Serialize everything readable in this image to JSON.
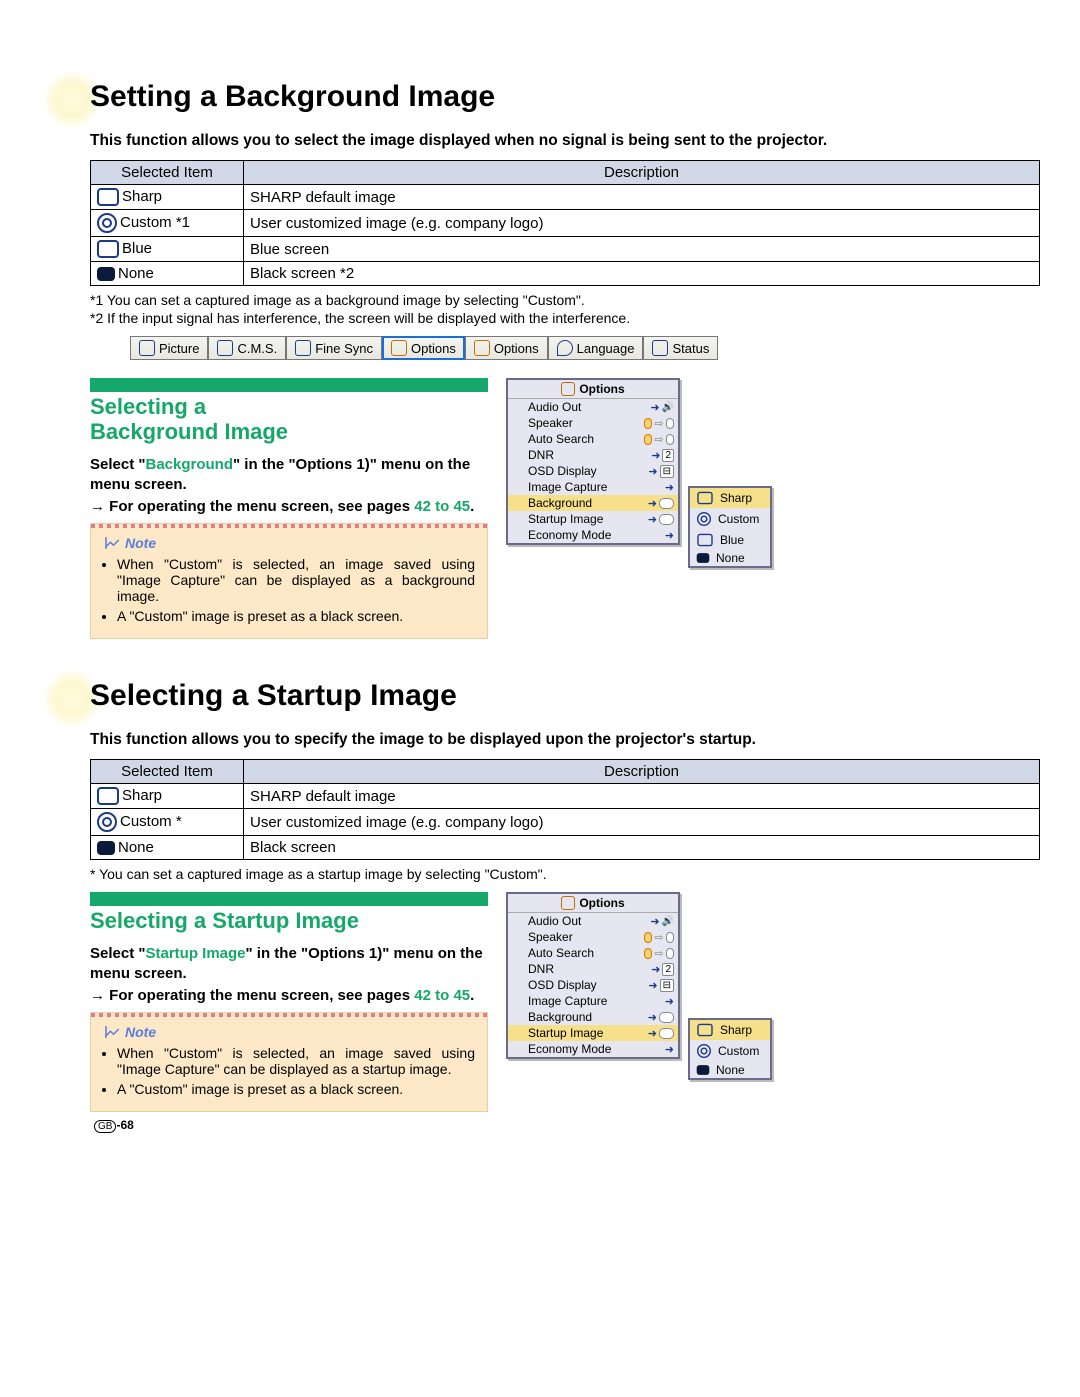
{
  "section1": {
    "title": "Setting a Background Image",
    "intro": "This function allows you to select the image displayed when no signal is being sent to the projector.",
    "table": {
      "headers": [
        "Selected Item",
        "Description"
      ],
      "rows": [
        {
          "item": "Sharp",
          "desc": "SHARP default image",
          "icon": "box"
        },
        {
          "item": "Custom *1",
          "desc": "User customized image (e.g. company logo)",
          "icon": "target"
        },
        {
          "item": "Blue",
          "desc": "Blue screen",
          "icon": "box"
        },
        {
          "item": "None",
          "desc": "Black screen *2",
          "icon": "dark"
        }
      ]
    },
    "footnotes": [
      "*1 You can set a captured image as a background image by selecting \"Custom\".",
      "*2 If the input signal has interference, the screen will be displayed with the interference."
    ]
  },
  "menu_tabs": [
    "Picture",
    "C.M.S.",
    "Fine Sync",
    "Options",
    "Options",
    "Language",
    "Status"
  ],
  "menu_tabs_selected_index": 3,
  "block1": {
    "heading_line1": "Selecting a",
    "heading_line2": "Background Image",
    "instr_a": "Select \"",
    "instr_kw": "Background",
    "instr_b": "\" in the \"Options 1)\" menu on the menu screen.",
    "instr2a": "→ For operating the menu screen, see pages ",
    "instr2_pg": "42 to 45",
    "instr2b": ".",
    "note_label": "Note",
    "notes": [
      "When \"Custom\" is selected, an image saved using \"Image Capture\" can be displayed as a background image.",
      "A \"Custom\" image is preset as a black screen."
    ]
  },
  "osd1": {
    "title": "Options",
    "rows": [
      {
        "name": "Audio Out",
        "ctl_type": "arrow-val",
        "val": "◄🔊►"
      },
      {
        "name": "Speaker",
        "ctl_type": "pill",
        "on": true
      },
      {
        "name": "Auto Search",
        "ctl_type": "pill",
        "on": true
      },
      {
        "name": "DNR",
        "ctl_type": "arrow-num",
        "val": "2"
      },
      {
        "name": "OSD Display",
        "ctl_type": "arrow-icon"
      },
      {
        "name": "Image Capture",
        "ctl_type": "arrow"
      },
      {
        "name": "Background",
        "ctl_type": "arrow-pill",
        "sel": true
      },
      {
        "name": "Startup Image",
        "ctl_type": "arrow-pill"
      },
      {
        "name": "Economy Mode",
        "ctl_type": "arrow"
      }
    ],
    "submenu": [
      "Sharp",
      "Custom",
      "Blue",
      "None"
    ],
    "submenu_sel": 0
  },
  "section2": {
    "title": "Selecting a Startup Image",
    "intro": "This function allows you to specify the image to be displayed upon the projector's startup.",
    "table": {
      "headers": [
        "Selected Item",
        "Description"
      ],
      "rows": [
        {
          "item": "Sharp",
          "desc": "SHARP default image",
          "icon": "box"
        },
        {
          "item": "Custom *",
          "desc": "User customized image (e.g. company logo)",
          "icon": "target"
        },
        {
          "item": "None",
          "desc": "Black screen",
          "icon": "dark"
        }
      ]
    },
    "footnotes": [
      "* You can set a captured image as a startup image by selecting \"Custom\"."
    ]
  },
  "block2": {
    "heading": "Selecting a Startup Image",
    "instr_a": "Select \"",
    "instr_kw": "Startup Image",
    "instr_b": "\" in the \"Options 1)\" menu on the menu screen.",
    "instr2a": "→ For operating the menu screen, see pages ",
    "instr2_pg": "42 to 45",
    "instr2b": ".",
    "note_label": "Note",
    "notes": [
      "When \"Custom\" is selected, an image saved using \"Image Capture\" can be displayed as a startup image.",
      "A \"Custom\" image is preset as a black screen."
    ]
  },
  "osd2": {
    "title": "Options",
    "rows": [
      {
        "name": "Audio Out",
        "ctl_type": "arrow-val",
        "val": "◄🔊►"
      },
      {
        "name": "Speaker",
        "ctl_type": "pill",
        "on": true
      },
      {
        "name": "Auto Search",
        "ctl_type": "pill",
        "on": true
      },
      {
        "name": "DNR",
        "ctl_type": "arrow-num",
        "val": "2"
      },
      {
        "name": "OSD Display",
        "ctl_type": "arrow-icon"
      },
      {
        "name": "Image Capture",
        "ctl_type": "arrow"
      },
      {
        "name": "Background",
        "ctl_type": "arrow-pill"
      },
      {
        "name": "Startup Image",
        "ctl_type": "arrow-pill",
        "sel": true
      },
      {
        "name": "Economy Mode",
        "ctl_type": "arrow"
      }
    ],
    "submenu": [
      "Sharp",
      "Custom",
      "None"
    ],
    "submenu_sel": 0
  },
  "page_num_prefix": "GB",
  "page_num": "-68"
}
